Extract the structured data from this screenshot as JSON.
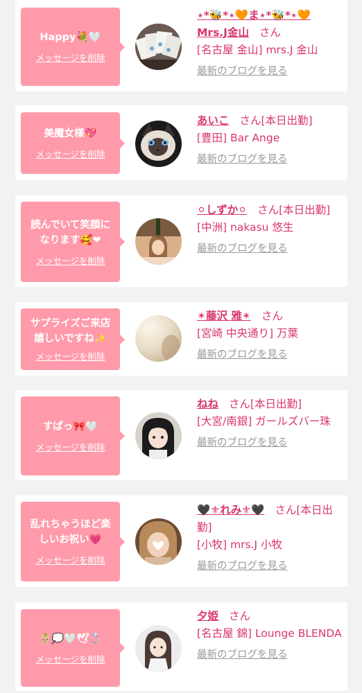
{
  "delete_label": "メッセージを削除",
  "san_suffix": "さん",
  "blog_label": "最新のブログを見る",
  "colors": {
    "accent": "#d9366a",
    "bubble": "#ff9aaa",
    "muted": "#999999"
  },
  "entries": [
    {
      "message": "Happy💐🤍",
      "name": "⋆*🐝*⋆🧡ま⋆*🐝*⋆🧡 Mrs.J金山",
      "san_suffix_extra": "",
      "shop_line": "[名古屋 金山] mrs.J 金山"
    },
    {
      "message": "美魔女様💖",
      "name": "あいこ",
      "san_suffix_extra": "[本日出勤]",
      "shop_line": "[豊田] Bar Ange"
    },
    {
      "message": "読んでいて笑顔になります🥰❤",
      "name": "⚪しずか⚪",
      "san_suffix_extra": "[本日出勤]",
      "shop_line": "[中洲] nakasu 悠生"
    },
    {
      "message": "サプライズご来店嬉しいですね✨",
      "name": "✴藤沢 雅✴",
      "san_suffix_extra": "",
      "shop_line": "[宮崎 中央通り] 万葉"
    },
    {
      "message": "すぱっ🎀🤍",
      "name": "ねね",
      "san_suffix_extra": "[本日出勤]",
      "shop_line": "[大宮/南銀] ガールズバー珠"
    },
    {
      "message": "乱れちゃうほど楽しいお祝い💗",
      "name": "🖤⚜れみ⚜🖤",
      "san_suffix_extra": "[本日出勤]",
      "shop_line": "[小牧] mrs.J 小牧"
    },
    {
      "message": "👶🏼💭🤍🕊💍",
      "name": "夕姫",
      "san_suffix_extra": "",
      "shop_line": "[名古屋 錦] Lounge BLENDA"
    }
  ]
}
